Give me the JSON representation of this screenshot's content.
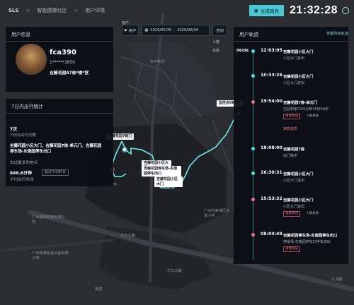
{
  "topbar": {
    "logo": "SLS",
    "crumbs": [
      "智能健康社区",
      "用户详情"
    ],
    "sep": ">",
    "service_label": "生成报表",
    "clock": "21:32:28"
  },
  "filter": {
    "label_top": "用户",
    "select_label": "用户",
    "date_start": "2020/05/30",
    "date_sep": "-",
    "date_end": "2020/06/04",
    "query_label": "查询"
  },
  "map_controls": [
    "人数",
    "关系"
  ],
  "user_panel": {
    "title": "用户信息",
    "name": "fca390",
    "phone": "1******3850",
    "address": "吉藤花园A7栋*楼*室"
  },
  "stats_panel": {
    "title": "7日内出行统计",
    "trips_value": "7次",
    "trips_label": "7日内出行次数",
    "places": "吉藤花园小区大门、吉藤花园7栋-单元门、吉藤花园停车场-东南园停车出口",
    "places_label": "去过最多的地点",
    "duration_value": "646.6分钟",
    "duration_tag": "超过平均时长",
    "duration_label": "平均出行时间"
  },
  "track_panel": {
    "title": "用户轨迹",
    "link": "查看所有轨迹",
    "entries": [
      {
        "date": "06/06",
        "time": "12:03:05",
        "place": "吉藤花园小区大门",
        "status": "小区大门进出",
        "dot": "cyan"
      },
      {
        "date": "",
        "time": "10:33:26",
        "place": "吉藤花园小区大门",
        "status": "小区大门进出",
        "dot": "cyan"
      },
      {
        "date": "",
        "time": "19:54:00",
        "place": "吉藤花园7栋-单元门",
        "status": "已回到家中25分钟35秒59秒",
        "extra": "家庭成员",
        "tag1": "访客标记",
        "tag2": "人群关系",
        "dot": "red"
      },
      {
        "date": "",
        "time": "18:08:00",
        "place": "吉藤花园7栋",
        "status": "出门散步",
        "dot": "cyan"
      },
      {
        "date": "",
        "time": "16:30:31",
        "place": "吉藤花园小区大门",
        "status": "小区大门进出",
        "dot": "cyan"
      },
      {
        "date": "",
        "time": "15:53:32",
        "place": "吉藤花园小区大门",
        "status": "小区大门进出",
        "tag1": "访客标记",
        "tag2": "人群关系",
        "dot": "red"
      },
      {
        "date": "",
        "time": "08:04:49",
        "place": "吉藤花园停车场-东南园停车出口",
        "status": "停车场-东南园停车口停车进出",
        "tag1": "访客标记",
        "dot": "red"
      }
    ]
  },
  "map_labels": {
    "popup_top": "监控点06/05",
    "popup_a": "吉藤花园7栋门",
    "popup_b": "吉藤花园小区大门",
    "popup_c": "吉藤花园停车场-东南园停车出口",
    "popup_d": "吉藤花园小区大门",
    "road1": "光华北路",
    "road2": "光华北路",
    "school": "广州市黄埔区东发小学",
    "north": "禾丰新村",
    "bottom_left1": "广州振通机械有限公司",
    "bottom_left2": "广州新鑫包装设备有限公司",
    "bottom": "笼屋",
    "right_road": "九龙路",
    "misc1": "香港大学"
  },
  "colors": {
    "accent": "#49c9d4",
    "track": "#6fe9f1",
    "alert": "#f06c7c"
  }
}
